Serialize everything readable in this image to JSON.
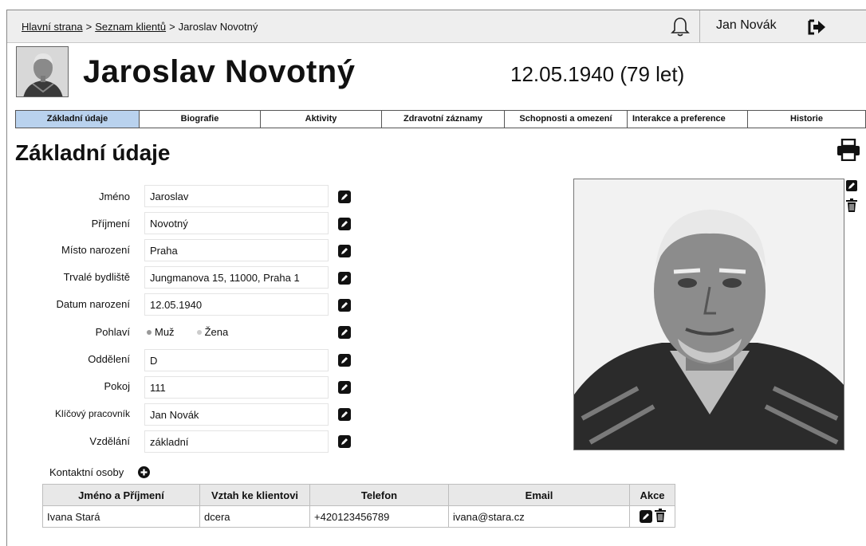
{
  "breadcrumb": {
    "home": "Hlavní strana",
    "clients": "Seznam klientů",
    "current": "Jaroslav Novotný",
    "separator": ">"
  },
  "user": {
    "name": "Jan Novák"
  },
  "client": {
    "name": "Jaroslav Novotný",
    "birth_age": "12.05.1940 (79 let)"
  },
  "tabs": [
    {
      "label": "Základní údaje",
      "active": true
    },
    {
      "label": "Biografie"
    },
    {
      "label": "Aktivity"
    },
    {
      "label": "Zdravotní záznamy"
    },
    {
      "label": "Schopnosti a omezení"
    },
    {
      "label": "Interakce a preference"
    },
    {
      "label": "Historie"
    }
  ],
  "section": {
    "title": "Základní údaje"
  },
  "form": {
    "first_name": {
      "label": "Jméno",
      "value": "Jaroslav"
    },
    "last_name": {
      "label": "Příjmení",
      "value": "Novotný"
    },
    "birth_place": {
      "label": "Místo narození",
      "value": "Praha"
    },
    "address": {
      "label": "Trvalé bydliště",
      "value": "Jungmanova 15, 11000, Praha 1"
    },
    "birth_date": {
      "label": "Datum narození",
      "value": "12.05.1940"
    },
    "gender": {
      "label": "Pohlaví",
      "options": [
        "Muž",
        "Žena"
      ],
      "selected": "Muž"
    },
    "department": {
      "label": "Oddělení",
      "value": "D"
    },
    "room": {
      "label": "Pokoj",
      "value": "111"
    },
    "key_worker": {
      "label": "Klíčový pracovník",
      "value": "Jan Novák"
    },
    "education": {
      "label": "Vzdělání",
      "value": "základní"
    }
  },
  "contacts": {
    "label": "Kontaktní osoby",
    "headers": [
      "Jméno a Příjmení",
      "Vztah ke klientovi",
      "Telefon",
      "Email",
      "Akce"
    ],
    "rows": [
      {
        "name": "Ivana Stará",
        "relation": "dcera",
        "phone": "+420123456789",
        "email": "ivana@stara.cz"
      }
    ]
  },
  "icons": {
    "bell": "bell-icon",
    "logout": "logout-icon",
    "printer": "printer-icon",
    "edit": "pencil-icon",
    "delete": "trash-icon",
    "add": "plus-circle-icon"
  },
  "colors": {
    "active_tab": "#b9d2ee",
    "topbar": "#eeeeee",
    "table_header": "#e8e8e8"
  }
}
